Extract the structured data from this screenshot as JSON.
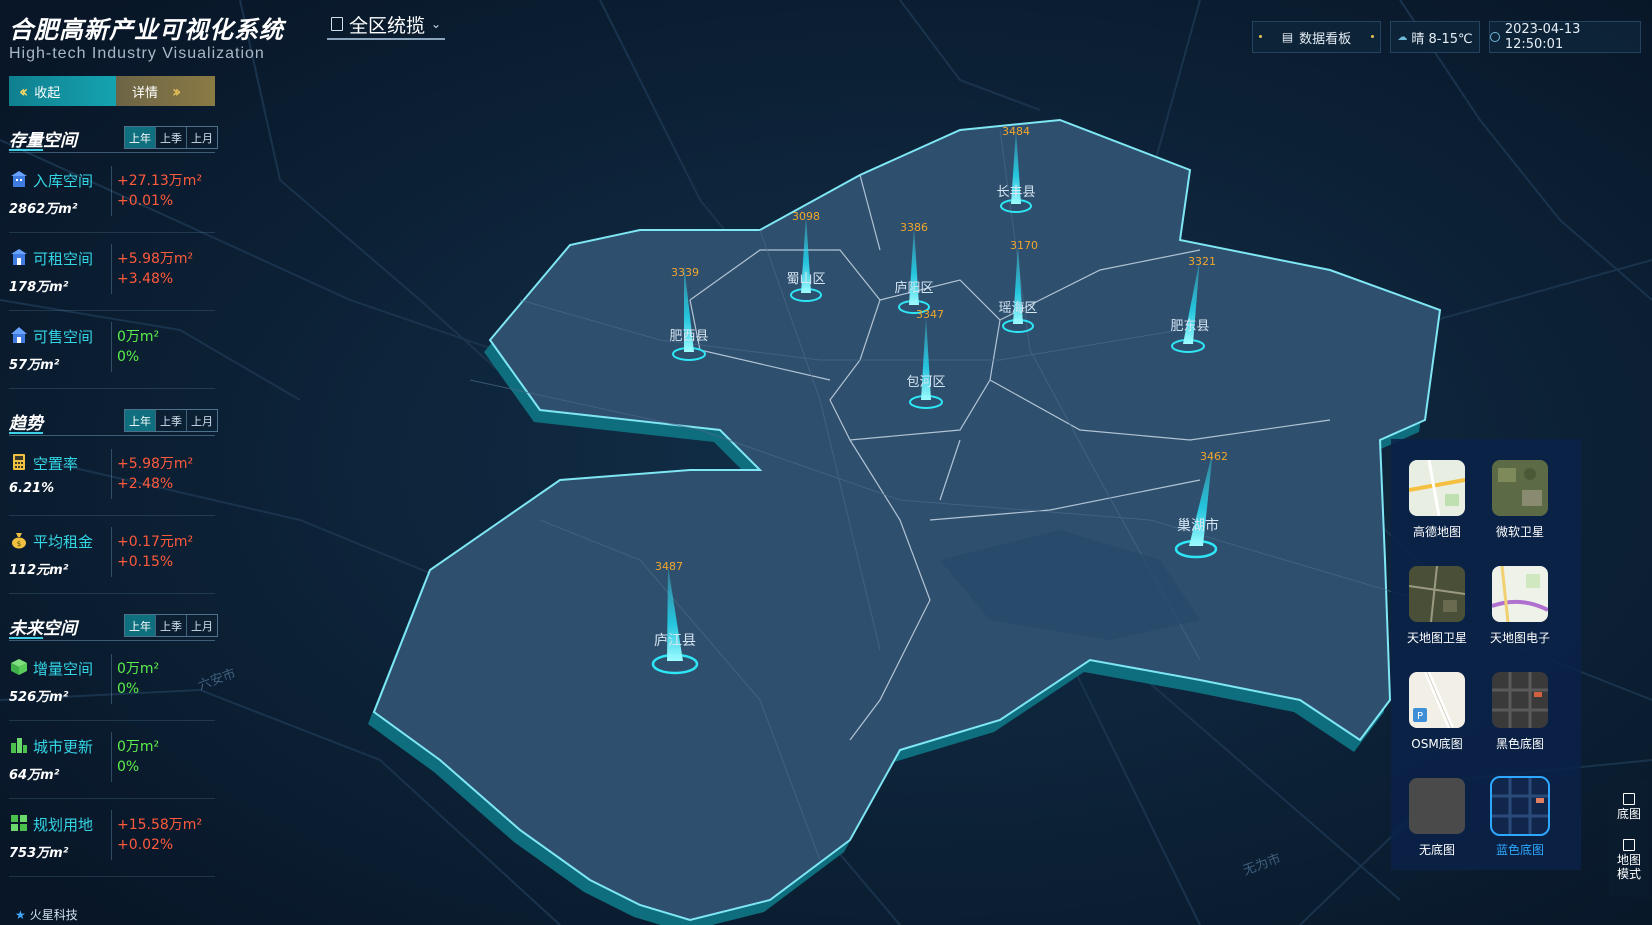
{
  "header": {
    "title": "合肥高新产业可视化系统",
    "subtitle": "High-tech Industry Visualization",
    "region_select": "全区统揽",
    "dashboard_label": "数据看板",
    "weather": "晴 8-15℃",
    "datetime": "2023-04-13 12:50:01"
  },
  "left_panel": {
    "collapse_label": "收起",
    "detail_label": "详情",
    "period_tabs": [
      "上年",
      "上季",
      "上月"
    ],
    "sections": [
      {
        "title": "存量空间",
        "metrics": [
          {
            "label": "入库空间",
            "value": "2862万m²",
            "delta1": "+27.13万m²",
            "delta2": "+0.01%",
            "icon": "building-icon"
          },
          {
            "label": "可租空间",
            "value": "178万m²",
            "delta1": "+5.98万m²",
            "delta2": "+3.48%",
            "icon": "building-icon"
          },
          {
            "label": "可售空间",
            "value": "57万m²",
            "delta1": "0万m²",
            "delta2": "0%",
            "icon": "house-icon"
          }
        ]
      },
      {
        "title": "趋势",
        "metrics": [
          {
            "label": "空置率",
            "value": "6.21%",
            "delta1": "+5.98万m²",
            "delta2": "+2.48%",
            "icon": "calculator-icon"
          },
          {
            "label": "平均租金",
            "value": "112元m²",
            "delta1": "+0.17元m²",
            "delta2": "+0.15%",
            "icon": "money-bag-icon"
          }
        ]
      },
      {
        "title": "未来空间",
        "metrics": [
          {
            "label": "增量空间",
            "value": "526万m²",
            "delta1": "0万m²",
            "delta2": "0%",
            "icon": "cube-icon"
          },
          {
            "label": "城市更新",
            "value": "64万m²",
            "delta1": "0万m²",
            "delta2": "0%",
            "icon": "city-icon"
          },
          {
            "label": "规划用地",
            "value": "753万m²",
            "delta1": "+15.58万m²",
            "delta2": "+0.02%",
            "icon": "grid-icon"
          }
        ]
      }
    ]
  },
  "map": {
    "districts": [
      {
        "name": "长丰县",
        "value": "3484"
      },
      {
        "name": "蜀山区",
        "value": "3098"
      },
      {
        "name": "庐阳区",
        "value": "3386"
      },
      {
        "name": "瑶海区",
        "value": "3170"
      },
      {
        "name": "肥西县",
        "value": "3339"
      },
      {
        "name": "包河区",
        "value": "3347"
      },
      {
        "name": "肥东县",
        "value": "3321"
      },
      {
        "name": "巢湖市",
        "value": "3462"
      },
      {
        "name": "庐江县",
        "value": "3487"
      }
    ],
    "background_labels": [
      "六安市",
      "无为市"
    ]
  },
  "basemaps": [
    {
      "label": "高德地图",
      "active": false
    },
    {
      "label": "微软卫星",
      "active": false
    },
    {
      "label": "天地图卫星",
      "active": false
    },
    {
      "label": "天地图电子",
      "active": false
    },
    {
      "label": "OSM底图",
      "active": false
    },
    {
      "label": "黑色底图",
      "active": false
    },
    {
      "label": "无底图",
      "active": false
    },
    {
      "label": "蓝色底图",
      "active": true
    }
  ],
  "side_tools": {
    "basemap": "底图",
    "map_mode": "地图模式"
  },
  "brand": "火星科技",
  "colors": {
    "accent": "#34d6e6",
    "increase": "#ff5a3c",
    "zero": "#5cf04a",
    "active_basemap": "#2ea8ff"
  }
}
